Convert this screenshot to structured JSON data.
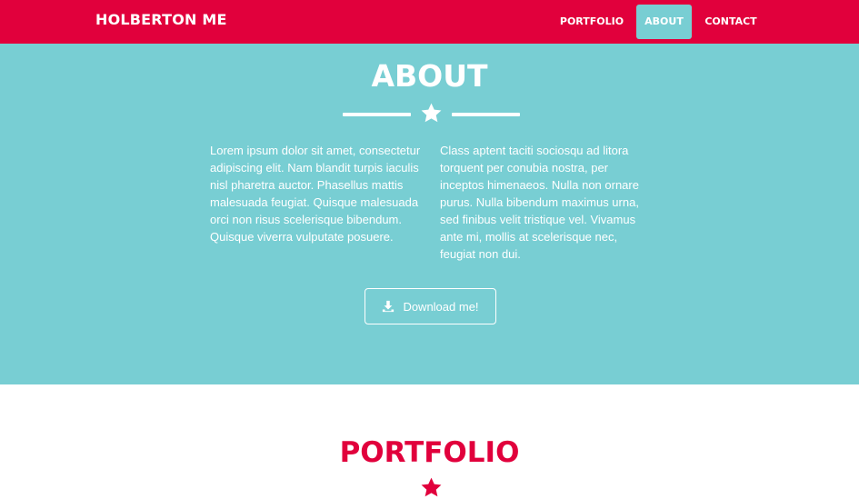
{
  "nav": {
    "brand": "HOLBERTON ME",
    "items": [
      {
        "label": "PORTFOLIO",
        "active": false
      },
      {
        "label": "ABOUT",
        "active": true
      },
      {
        "label": "CONTACT",
        "active": false
      }
    ]
  },
  "about": {
    "title": "ABOUT",
    "divider_icon": "star-icon",
    "col_left": "Lorem ipsum dolor sit amet, consectetur adipiscing elit. Nam blandit turpis iaculis nisl pharetra auctor. Phasellus mattis malesuada feugiat. Quisque malesuada orci non risus scelerisque bibendum. Quisque viverra vulputate posuere.",
    "col_right": "Class aptent taciti sociosqu ad litora torquent per conubia nostra, per inceptos himenaeos. Nulla non ornare purus. Nulla bibendum maximus urna, sed finibus velit tristique vel. Vivamus ante mi, mollis at scelerisque nec, feugiat non dui.",
    "download_label": "Download me!",
    "download_icon": "download-icon"
  },
  "portfolio": {
    "title": "PORTFOLIO"
  },
  "colors": {
    "primary": "#e1003c",
    "accent": "#78ced3",
    "white": "#ffffff"
  }
}
